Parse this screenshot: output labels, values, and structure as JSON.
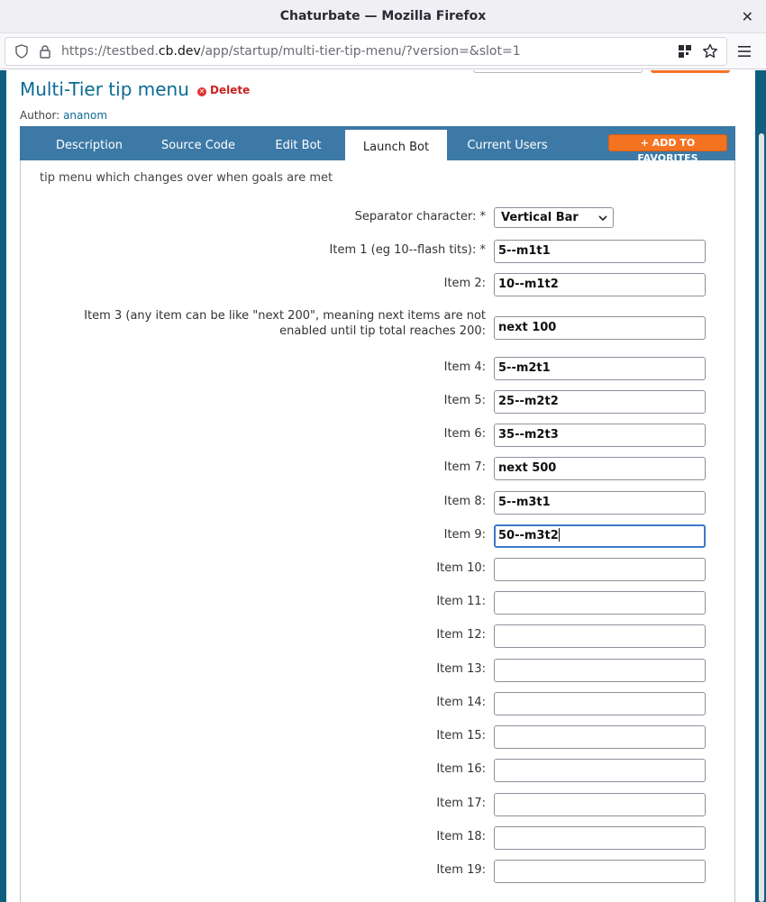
{
  "browser": {
    "window_title": "Chaturbate — Mozilla Firefox",
    "url_prefix": "https://testbed.",
    "url_host": "cb.dev",
    "url_path": "/app/startup/multi-tier-tip-menu/?version=&slot=1"
  },
  "page": {
    "title": "Multi-Tier tip menu",
    "delete_label": "Delete",
    "author_label": "Author:",
    "author_name": "ananom",
    "tabs": [
      "Description",
      "Source Code",
      "Edit Bot",
      "Launch Bot",
      "Current Users"
    ],
    "active_tab": "Launch Bot",
    "favorites_label": "+ ADD TO FAVORITES",
    "description": "tip menu which changes over when goals are met"
  },
  "form": {
    "separator_label": "Separator character: *",
    "separator_value": "Vertical Bar",
    "items": [
      {
        "label": "Item 1 (eg 10--flash tits): *",
        "value": "5--m1t1"
      },
      {
        "label": "Item 2:",
        "value": "10--m1t2"
      },
      {
        "label": "Item 3 (any item can be like \"next 200\", meaning next items are not enabled until tip total reaches 200:",
        "value": "next 100"
      },
      {
        "label": "Item 4:",
        "value": "5--m2t1"
      },
      {
        "label": "Item 5:",
        "value": "25--m2t2"
      },
      {
        "label": "Item 6:",
        "value": "35--m2t3"
      },
      {
        "label": "Item 7:",
        "value": "next 500"
      },
      {
        "label": "Item 8:",
        "value": "5--m3t1"
      },
      {
        "label": "Item 9:",
        "value": "50--m3t2"
      },
      {
        "label": "Item 10:",
        "value": ""
      },
      {
        "label": "Item 11:",
        "value": ""
      },
      {
        "label": "Item 12:",
        "value": ""
      },
      {
        "label": "Item 13:",
        "value": ""
      },
      {
        "label": "Item 14:",
        "value": ""
      },
      {
        "label": "Item 15:",
        "value": ""
      },
      {
        "label": "Item 16:",
        "value": ""
      },
      {
        "label": "Item 17:",
        "value": ""
      },
      {
        "label": "Item 18:",
        "value": ""
      },
      {
        "label": "Item 19:",
        "value": ""
      }
    ]
  },
  "colors": {
    "header_blue": "#3d79a6",
    "title_blue": "#0c6a93",
    "accent_orange": "#f47321",
    "page_bg": "#0f5e7f"
  }
}
